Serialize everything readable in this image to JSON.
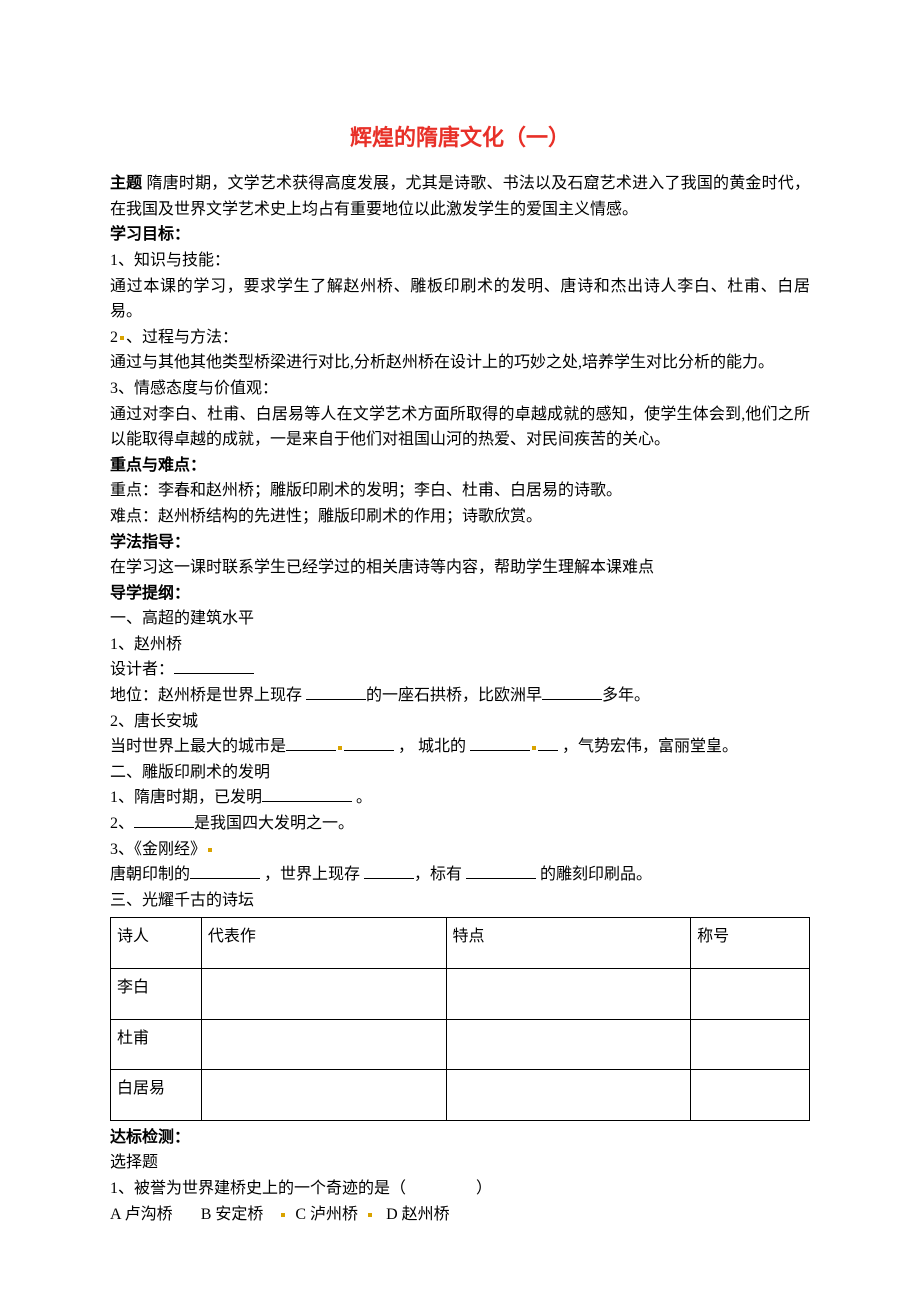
{
  "title": "辉煌的隋唐文化（一）",
  "theme_label": "主题",
  "theme_text": "  隋唐时期，文学艺术获得高度发展，尤其是诗歌、书法以及石窟艺术进入了我国的黄金时代，在我国及世界文学艺术史上均占有重要地位以此激发学生的爱国主义情感。",
  "objectives_label": "学习目标：",
  "obj1_head": "1、知识与技能：",
  "obj1_body": "通过本课的学习，要求学生了解赵州桥、雕板印刷术的发明、唐诗和杰出诗人李白、杜甫、白居易。",
  "obj2_head": "2",
  "obj2_head_tail": "、过程与方法：",
  "obj2_body": "通过与其他其他类型桥梁进行对比,分析赵州桥在设计上的巧妙之处,培养学生对比分析的能力。",
  "obj3_head": "3、情感态度与价值观：",
  "obj3_body": "通过对李白、杜甫、白居易等人在文学艺术方面所取得的卓越成就的感知，使学生体会到,他们之所以能取得卓越的成就，一是来自于他们对祖国山河的热爱、对民间疾苦的关心。",
  "keydiff_label": "重点与难点：",
  "keypoint": "重点：李春和赵州桥；雕版印刷术的发明；李白、杜甫、白居易的诗歌。",
  "difficulty": "难点：赵州桥结构的先进性；雕版印刷术的作用；诗歌欣赏。",
  "method_label": "学法指导：",
  "method_body": "在学习这一课时联系学生已经学过的相关唐诗等内容，帮助学生理解本课难点",
  "outline_label": "导学提纲：",
  "sec1": "一、高超的建筑水平",
  "s1_1": "1、赵州桥",
  "s1_1_designer_pre": "设计者：",
  "s1_1_status_a": "地位：赵州桥是世界上现存 ",
  "s1_1_status_b": "的一座石拱桥，比欧洲早",
  "s1_1_status_c": "多年。",
  "s1_2": "2、唐长安城",
  "s1_2_a": "当时世界上最大的城市是",
  "s1_2_b": " ， 城北的 ",
  "s1_2_c": " ，气势宏伟，富丽堂皇。",
  "sec2": "二、雕版印刷术的发明",
  "s2_1_a": "1、隋唐时期，已发明",
  "s2_1_b": " 。",
  "s2_2_a": "2、",
  "s2_2_b": "是我国四大发明之一。",
  "s2_3_a": "3、《金刚经》",
  "s2_3_b_a": "唐朝印制的",
  "s2_3_b_b": " ，世界上现存 ",
  "s2_3_b_c": "，标有 ",
  "s2_3_b_d": " 的雕刻印刷品。",
  "sec3": "三、光耀千古的诗坛",
  "table": {
    "th": [
      "诗人",
      "代表作",
      "特点",
      "称号"
    ],
    "rows": [
      "李白",
      "杜甫",
      "白居易"
    ]
  },
  "test_label": "达标检测：",
  "test_type": "选择题",
  "q1": "1、被誉为世界建桥史上的一个奇迹的是（",
  "q1_end": "）",
  "q1_opts": {
    "a": "A 卢沟桥",
    "b": "B 安定桥",
    "c": "C 泸州桥",
    "d": "D 赵州桥"
  }
}
